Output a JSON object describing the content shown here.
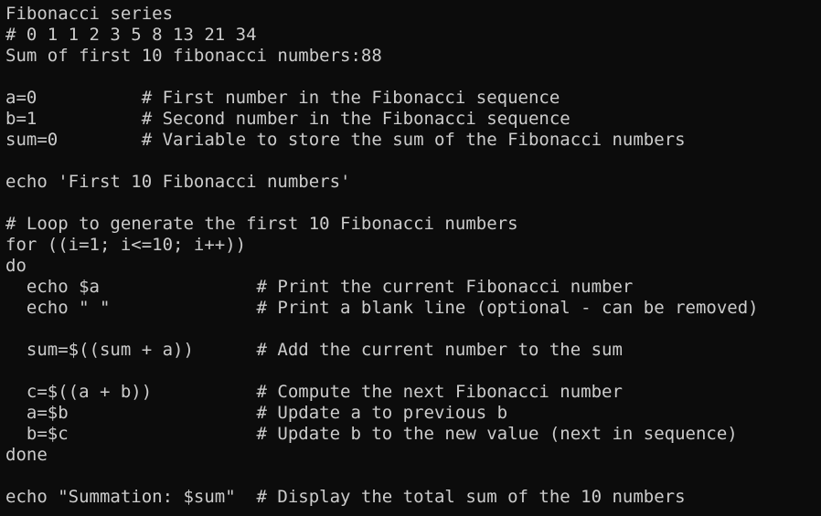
{
  "terminal": {
    "lines": [
      "Fibonacci series",
      "# 0 1 1 2 3 5 8 13 21 34",
      "Sum of first 10 fibonacci numbers:88",
      "",
      "a=0          # First number in the Fibonacci sequence",
      "b=1          # Second number in the Fibonacci sequence",
      "sum=0        # Variable to store the sum of the Fibonacci numbers",
      "",
      "echo 'First 10 Fibonacci numbers'",
      "",
      "# Loop to generate the first 10 Fibonacci numbers",
      "for ((i=1; i<=10; i++))",
      "do",
      "  echo $a               # Print the current Fibonacci number",
      "  echo \" \"              # Print a blank line (optional - can be removed)",
      "",
      "  sum=$((sum + a))      # Add the current number to the sum",
      "",
      "  c=$((a + b))          # Compute the next Fibonacci number",
      "  a=$b                  # Update a to previous b",
      "  b=$c                  # Update b to the new value (next in sequence)",
      "done",
      "",
      "echo \"Summation: $sum\"  # Display the total sum of the 10 numbers"
    ]
  }
}
